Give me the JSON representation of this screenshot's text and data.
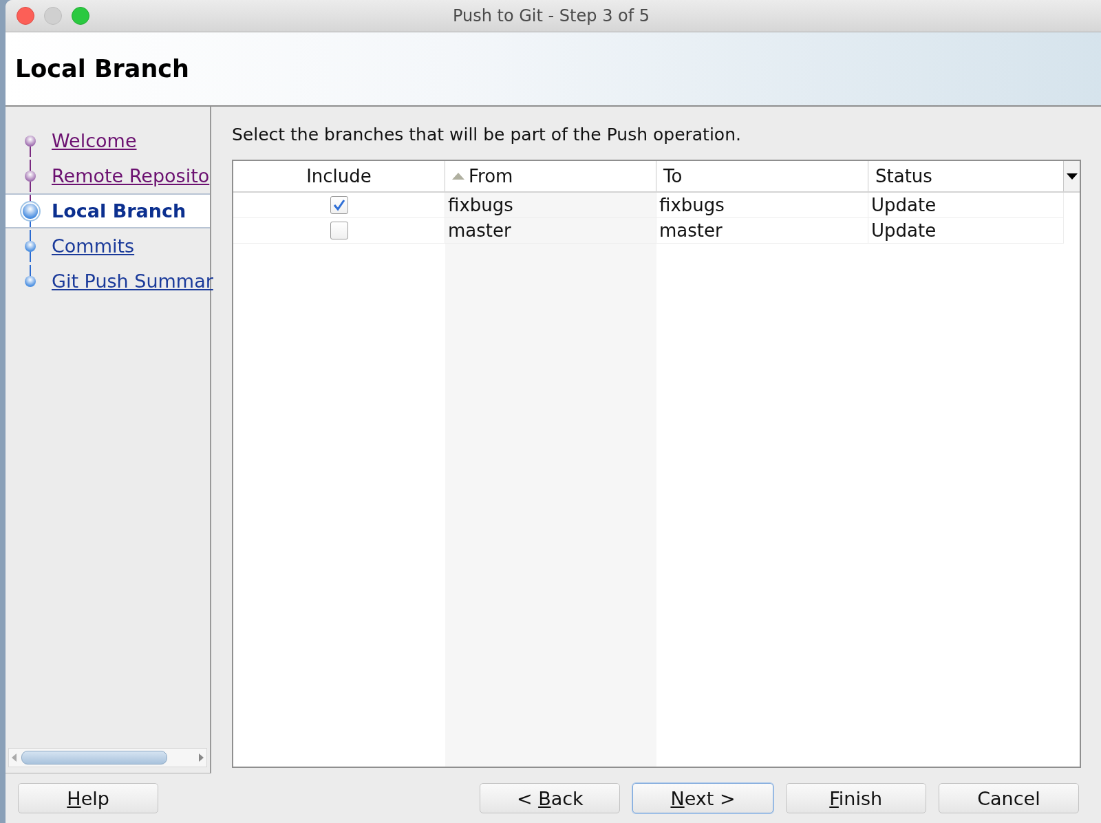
{
  "window": {
    "title": "Push to Git - Step 3 of 5"
  },
  "header": {
    "title": "Local Branch"
  },
  "steps": [
    {
      "label": "Welcome",
      "visited": true,
      "selected": false
    },
    {
      "label": "Remote Reposito",
      "visited": true,
      "selected": false
    },
    {
      "label": "Local Branch",
      "visited": true,
      "selected": true
    },
    {
      "label": "Commits",
      "visited": false,
      "selected": false
    },
    {
      "label": "Git Push Summar",
      "visited": false,
      "selected": false
    }
  ],
  "instruction": "Select the branches that will be part of the Push operation.",
  "table": {
    "columns": [
      {
        "label": "Include",
        "kind": "checkbox",
        "sorted": false
      },
      {
        "label": "From",
        "kind": "text",
        "sorted": true
      },
      {
        "label": "To",
        "kind": "text",
        "sorted": false
      },
      {
        "label": "Status",
        "kind": "text",
        "sorted": false
      }
    ],
    "rows": [
      {
        "include": true,
        "from": "fixbugs",
        "to": "fixbugs",
        "status": "Update"
      },
      {
        "include": false,
        "from": "master",
        "to": "master",
        "status": "Update"
      }
    ]
  },
  "buttons": [
    {
      "kind": "left",
      "label_parts": [
        {
          "text": "H",
          "mnemonic": true
        },
        {
          "text": "elp",
          "mnemonic": false
        }
      ],
      "focused": false
    },
    {
      "kind": "right",
      "label_parts": [
        {
          "text": "< ",
          "mnemonic": false
        },
        {
          "text": "B",
          "mnemonic": true
        },
        {
          "text": "ack",
          "mnemonic": false
        }
      ],
      "focused": false
    },
    {
      "kind": "right",
      "label_parts": [
        {
          "text": "N",
          "mnemonic": true
        },
        {
          "text": "ext >",
          "mnemonic": false
        }
      ],
      "focused": true
    },
    {
      "kind": "right",
      "label_parts": [
        {
          "text": "F",
          "mnemonic": true
        },
        {
          "text": "inish",
          "mnemonic": false
        }
      ],
      "focused": false
    },
    {
      "kind": "right",
      "label_parts": [
        {
          "text": "Cancel",
          "mnemonic": false
        }
      ],
      "focused": false
    }
  ]
}
